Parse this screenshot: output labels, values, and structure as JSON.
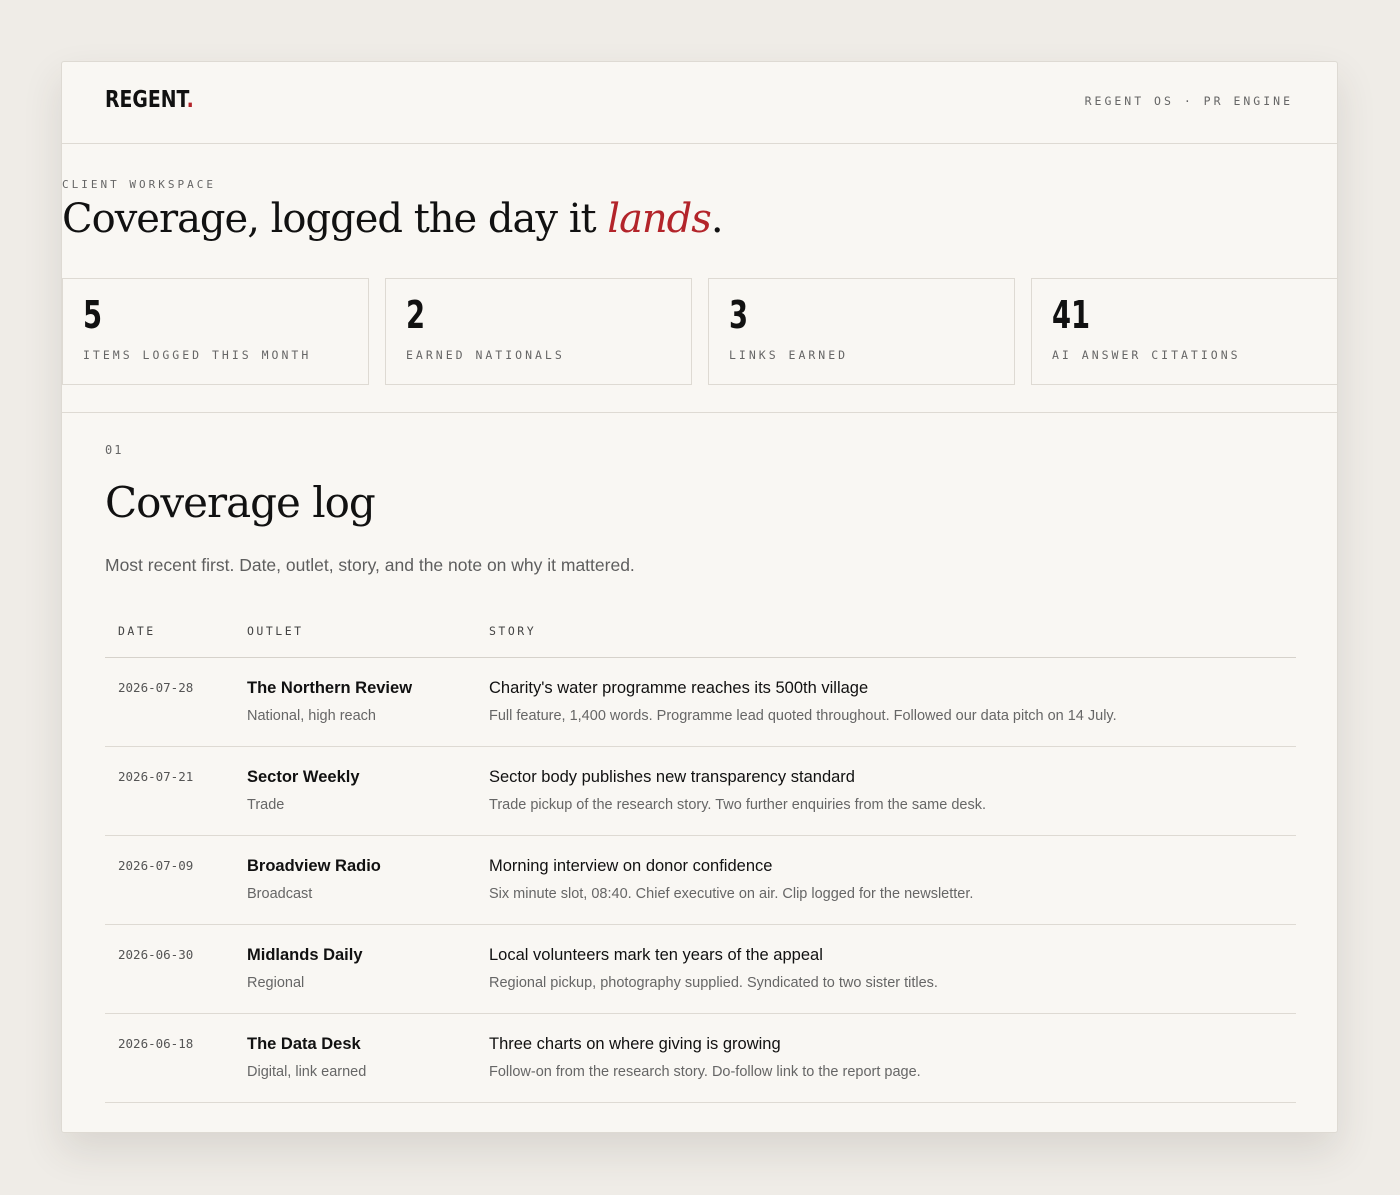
{
  "brand": {
    "logo_text": "REGENT",
    "logo_dot": ".",
    "accent": "#b3242a"
  },
  "header": {
    "nav_text": "REGENT OS · PR ENGINE"
  },
  "hero": {
    "eyebrow": "CLIENT WORKSPACE",
    "headline_prefix": "Coverage, logged the day it ",
    "headline_emphasis": "lands",
    "headline_suffix": "."
  },
  "stats": [
    {
      "value": "5",
      "label": "ITEMS LOGGED THIS MONTH"
    },
    {
      "value": "2",
      "label": "EARNED NATIONALS"
    },
    {
      "value": "3",
      "label": "LINKS EARNED"
    },
    {
      "value": "41",
      "label": "AI ANSWER CITATIONS"
    }
  ],
  "section": {
    "number": "01",
    "title": "Coverage log",
    "description": "Most recent first. Date, outlet, story, and the note on why it mattered."
  },
  "table": {
    "columns": [
      "DATE",
      "OUTLET",
      "STORY"
    ],
    "rows": [
      {
        "date": "2026-07-28",
        "outlet": "The Northern Review",
        "outlet_type": "National, high reach",
        "story": "Charity's water programme reaches its 500th village",
        "note": "Full feature, 1,400 words. Programme lead quoted throughout. Followed our data pitch on 14 July."
      },
      {
        "date": "2026-07-21",
        "outlet": "Sector Weekly",
        "outlet_type": "Trade",
        "story": "Sector body publishes new transparency standard",
        "note": "Trade pickup of the research story. Two further enquiries from the same desk."
      },
      {
        "date": "2026-07-09",
        "outlet": "Broadview Radio",
        "outlet_type": "Broadcast",
        "story": "Morning interview on donor confidence",
        "note": "Six minute slot, 08:40. Chief executive on air. Clip logged for the newsletter."
      },
      {
        "date": "2026-06-30",
        "outlet": "Midlands Daily",
        "outlet_type": "Regional",
        "story": "Local volunteers mark ten years of the appeal",
        "note": "Regional pickup, photography supplied. Syndicated to two sister titles."
      },
      {
        "date": "2026-06-18",
        "outlet": "The Data Desk",
        "outlet_type": "Digital, link earned",
        "story": "Three charts on where giving is growing",
        "note": "Follow-on from the research story. Do-follow link to the report page."
      }
    ]
  }
}
